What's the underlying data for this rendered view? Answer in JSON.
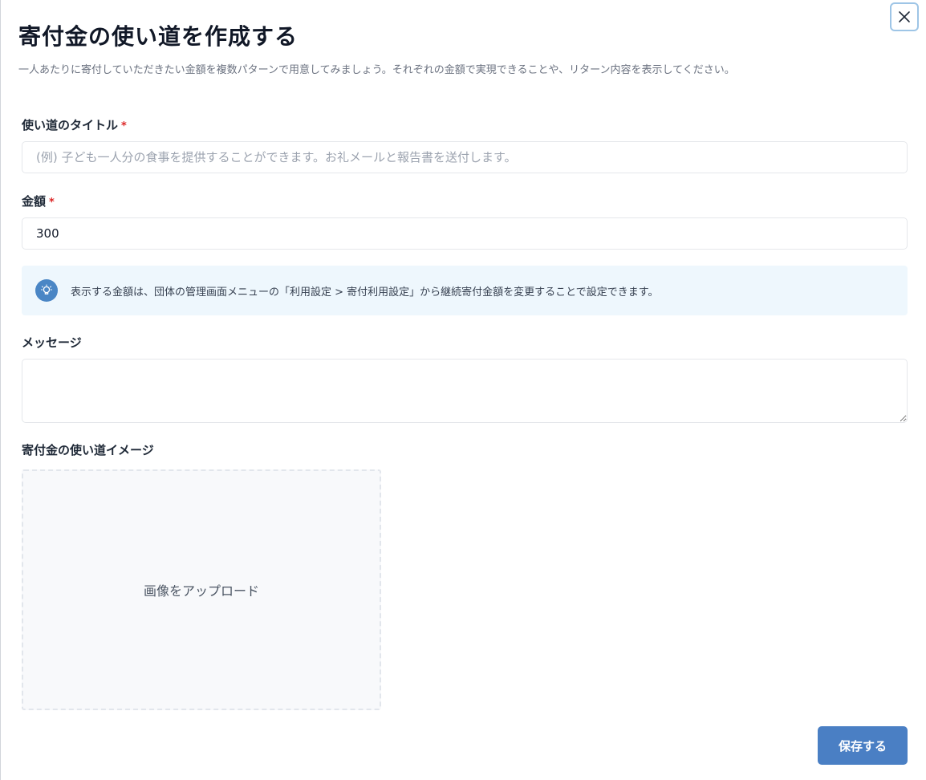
{
  "modal": {
    "title": "寄付金の使い道を作成する",
    "description": "一人あたりに寄付していただきたい金額を複数パターンで用意してみましょう。それぞれの金額で実現できることや、リターン内容を表示してください。"
  },
  "form": {
    "title_field": {
      "label": "使い道のタイトル",
      "required_mark": "*",
      "placeholder": "(例) 子ども一人分の食事を提供することができます。お礼メールと報告書を送付します。",
      "value": ""
    },
    "amount_field": {
      "label": "金額",
      "required_mark": "*",
      "value": "300"
    },
    "info_notice": {
      "text": "表示する金額は、団体の管理画面メニューの「利用設定 > 寄付利用設定」から継続寄付金額を変更することで設定できます。",
      "icon": "lightbulb-icon"
    },
    "message_field": {
      "label": "メッセージ",
      "value": ""
    },
    "image_field": {
      "label": "寄付金の使い道イメージ",
      "upload_text": "画像をアップロード"
    }
  },
  "actions": {
    "save_label": "保存する",
    "close_icon": "close-icon"
  },
  "colors": {
    "primary": "#4a7fc4",
    "required": "#dc2626",
    "info_bg": "#eef7fd"
  }
}
